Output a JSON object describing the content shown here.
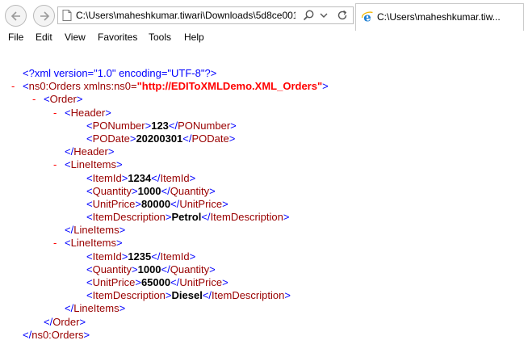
{
  "browser": {
    "address": "C:\\Users\\maheshkumar.tiwari\\Downloads\\5d8ce001-b",
    "tab_title": "C:\\Users\\maheshkumar.tiw..."
  },
  "menu": [
    "File",
    "Edit",
    "View",
    "Favorites",
    "Tools",
    "Help"
  ],
  "xml": {
    "declaration": "<?xml version=\"1.0\" encoding=\"UTF-8\"?>",
    "root_open_prefix": "<",
    "root_tag": "ns0:Orders",
    "root_attr_name": " xmlns:ns0=",
    "root_attr_value": "\"http://EDIToXMLDemo.XML_Orders\"",
    "root_open_suffix": ">",
    "order_tag": "Order",
    "header_tag": "Header",
    "po_number_tag": "PONumber",
    "po_number": "123",
    "po_date_tag": "PODate",
    "po_date": "20200301",
    "line_items_tag": "LineItems",
    "item_id_tag": "ItemId",
    "quantity_tag": "Quantity",
    "unit_price_tag": "UnitPrice",
    "item_description_tag": "ItemDescription",
    "items": [
      {
        "item_id": "1234",
        "quantity": "1000",
        "unit_price": "80000",
        "description": "Petrol"
      },
      {
        "item_id": "1235",
        "quantity": "1000",
        "unit_price": "65000",
        "description": "Diesel"
      }
    ]
  },
  "colors": {
    "bracket": "#0000ff",
    "tag_name": "#990000",
    "value": "#000000",
    "namespace_value": "#ff0000",
    "collapse_minus": "#ff0000"
  }
}
